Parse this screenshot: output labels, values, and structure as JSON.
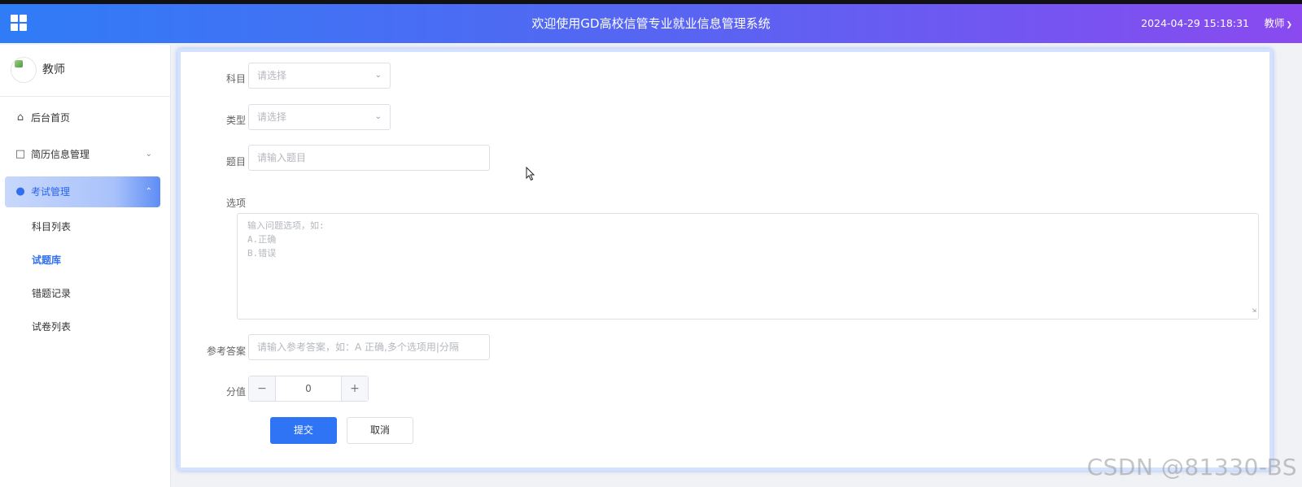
{
  "header": {
    "title": "欢迎使用GD高校信管专业就业信息管理系统",
    "datetime": "2024-04-29 15:18:31",
    "user": "教师",
    "menu_icon": "grid-icon"
  },
  "sidebar": {
    "profile_name": "教师",
    "items": [
      {
        "label": "后台首页",
        "icon": "home-icon"
      },
      {
        "label": "简历信息管理",
        "icon": "document-icon"
      },
      {
        "label": "考试管理",
        "icon": "location-pin-icon"
      }
    ],
    "sub_items": [
      {
        "label": "科目列表"
      },
      {
        "label": "试题库"
      },
      {
        "label": "错题记录"
      },
      {
        "label": "试卷列表"
      }
    ]
  },
  "form": {
    "subject": {
      "label": "科目",
      "placeholder": "请选择"
    },
    "type": {
      "label": "类型",
      "placeholder": "请选择"
    },
    "question": {
      "label": "题目",
      "placeholder": "请输入题目"
    },
    "options": {
      "label": "选项",
      "placeholder_line1": "输入问题选项，如:",
      "placeholder_line2": "A.正确",
      "placeholder_line3": "B.错误"
    },
    "answer": {
      "label": "参考答案",
      "placeholder": "请输入参考答案，如：A 正确,多个选项用|分隔"
    },
    "score": {
      "label": "分值",
      "value": "0",
      "minus": "−",
      "plus": "+"
    },
    "submit_label": "提交",
    "cancel_label": "取消"
  },
  "watermark": "CSDN @81330-BS",
  "colors": {
    "accent": "#2f74f5",
    "header_start": "#2f7cf6",
    "header_end": "#8a4af0"
  }
}
